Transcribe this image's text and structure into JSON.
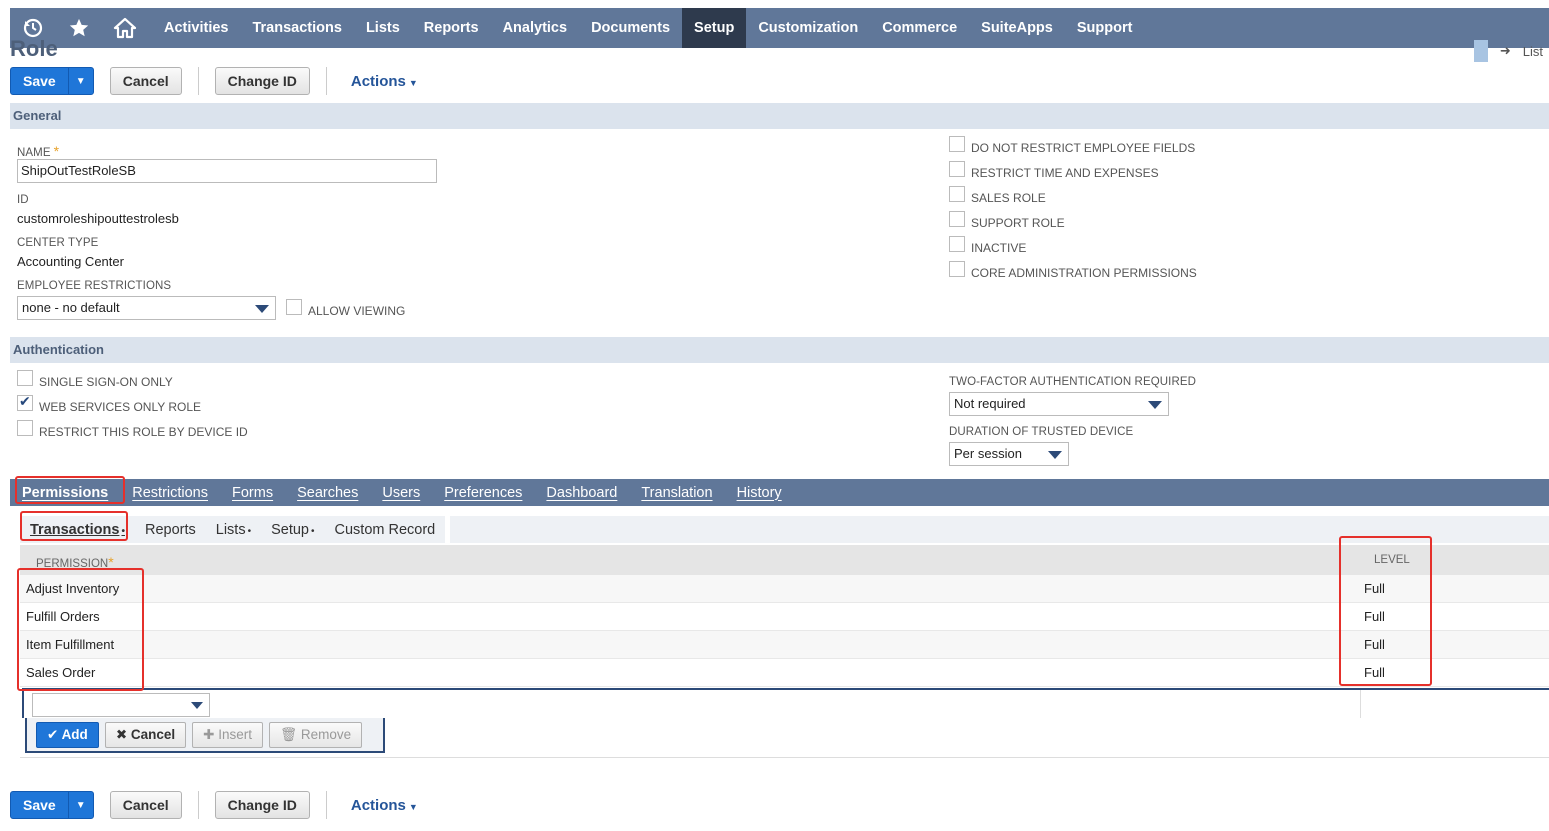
{
  "nav": {
    "items": [
      "Activities",
      "Transactions",
      "Lists",
      "Reports",
      "Analytics",
      "Documents",
      "Setup",
      "Customization",
      "Commerce",
      "SuiteApps",
      "Support"
    ],
    "active": "Setup"
  },
  "page": {
    "title": "Role",
    "list_link": "List"
  },
  "toolbar": {
    "save": "Save",
    "cancel": "Cancel",
    "change_id": "Change ID",
    "actions": "Actions"
  },
  "general": {
    "header": "General",
    "name_label": "NAME",
    "name_value": "ShipOutTestRoleSB",
    "id_label": "ID",
    "id_value": "customroleshipouttestrolesb",
    "center_type_label": "CENTER TYPE",
    "center_type_value": "Accounting Center",
    "emp_restrictions_label": "EMPLOYEE RESTRICTIONS",
    "emp_restrictions_value": "none - no default",
    "allow_viewing": "ALLOW VIEWING",
    "checkboxes": [
      {
        "label": "DO NOT RESTRICT EMPLOYEE FIELDS",
        "checked": false
      },
      {
        "label": "RESTRICT TIME AND EXPENSES",
        "checked": false
      },
      {
        "label": "SALES ROLE",
        "checked": false
      },
      {
        "label": "SUPPORT ROLE",
        "checked": false
      },
      {
        "label": "INACTIVE",
        "checked": false
      },
      {
        "label": "CORE ADMINISTRATION PERMISSIONS",
        "checked": false
      }
    ]
  },
  "authentication": {
    "header": "Authentication",
    "sso": "SINGLE SIGN-ON ONLY",
    "web_services": "WEB SERVICES ONLY ROLE",
    "restrict_device": "RESTRICT THIS ROLE BY DEVICE ID",
    "twofa_label": "TWO-FACTOR AUTHENTICATION REQUIRED",
    "twofa_value": "Not required",
    "duration_label": "DURATION OF TRUSTED DEVICE",
    "duration_value": "Per session"
  },
  "subtabs": [
    "Permissions",
    "Restrictions",
    "Forms",
    "Searches",
    "Users",
    "Preferences",
    "Dashboard",
    "Translation",
    "History"
  ],
  "innertabs": [
    "Transactions",
    "Reports",
    "Lists",
    "Setup",
    "Custom Record"
  ],
  "grid": {
    "col_permission": "PERMISSION",
    "col_level": "LEVEL",
    "rows": [
      {
        "permission": "Adjust Inventory",
        "level": "Full"
      },
      {
        "permission": "Fulfill Orders",
        "level": "Full"
      },
      {
        "permission": "Item Fulfillment",
        "level": "Full"
      },
      {
        "permission": "Sales Order",
        "level": "Full"
      }
    ]
  },
  "edit_buttons": {
    "add": "Add",
    "cancel": "Cancel",
    "insert": "Insert",
    "remove": "Remove"
  }
}
